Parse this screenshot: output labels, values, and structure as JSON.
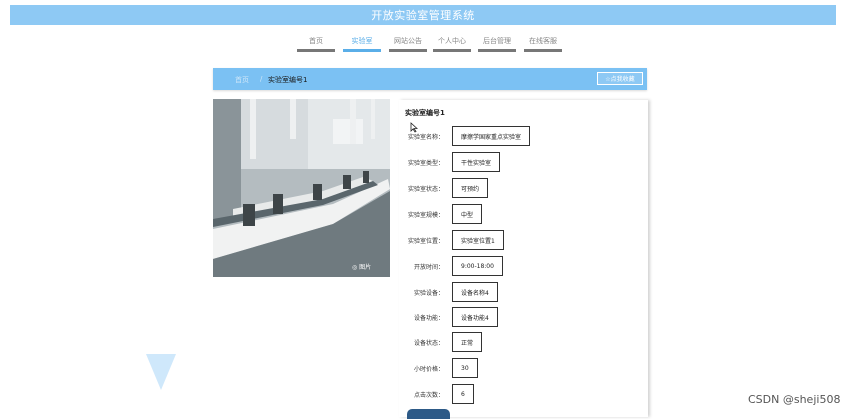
{
  "header": {
    "title": "开放实验室管理系统"
  },
  "nav": {
    "items": [
      {
        "label": "首页"
      },
      {
        "label": "实验室"
      },
      {
        "label": "网站公告"
      },
      {
        "label": "个人中心"
      },
      {
        "label": "后台管理"
      },
      {
        "label": "在线客服"
      }
    ],
    "active_index": 1
  },
  "breadcrumb": {
    "home": "首页",
    "separator": "/",
    "current": "实验室编号1"
  },
  "favorite_button": {
    "label": "☆点我收藏"
  },
  "detail": {
    "title": "实验室编号1",
    "fields": [
      {
        "key": "实验室名称：",
        "value": "摩擦学国家重点实验室"
      },
      {
        "key": "实验室类型：",
        "value": "干性实验室"
      },
      {
        "key": "实验室状态：",
        "value": "可预约"
      },
      {
        "key": "实验室规模：",
        "value": "中型"
      },
      {
        "key": "实验室位置：",
        "value": "实验室位置1"
      },
      {
        "key": "开放时间：",
        "value": "9:00-18:00"
      },
      {
        "key": "实验设备：",
        "value": "设备名称4"
      },
      {
        "key": "设备功能：",
        "value": "设备功能4"
      },
      {
        "key": "设备状态：",
        "value": "正常"
      },
      {
        "key": "小时价格：",
        "value": "30"
      },
      {
        "key": "点击次数：",
        "value": "6"
      }
    ]
  },
  "photo_watermark": "◎ 图片",
  "page_watermark": "CSDN @sheji508",
  "colors": {
    "primary": "#7bc1f3",
    "header": "#8ec9f4",
    "active": "#5aaee8"
  }
}
